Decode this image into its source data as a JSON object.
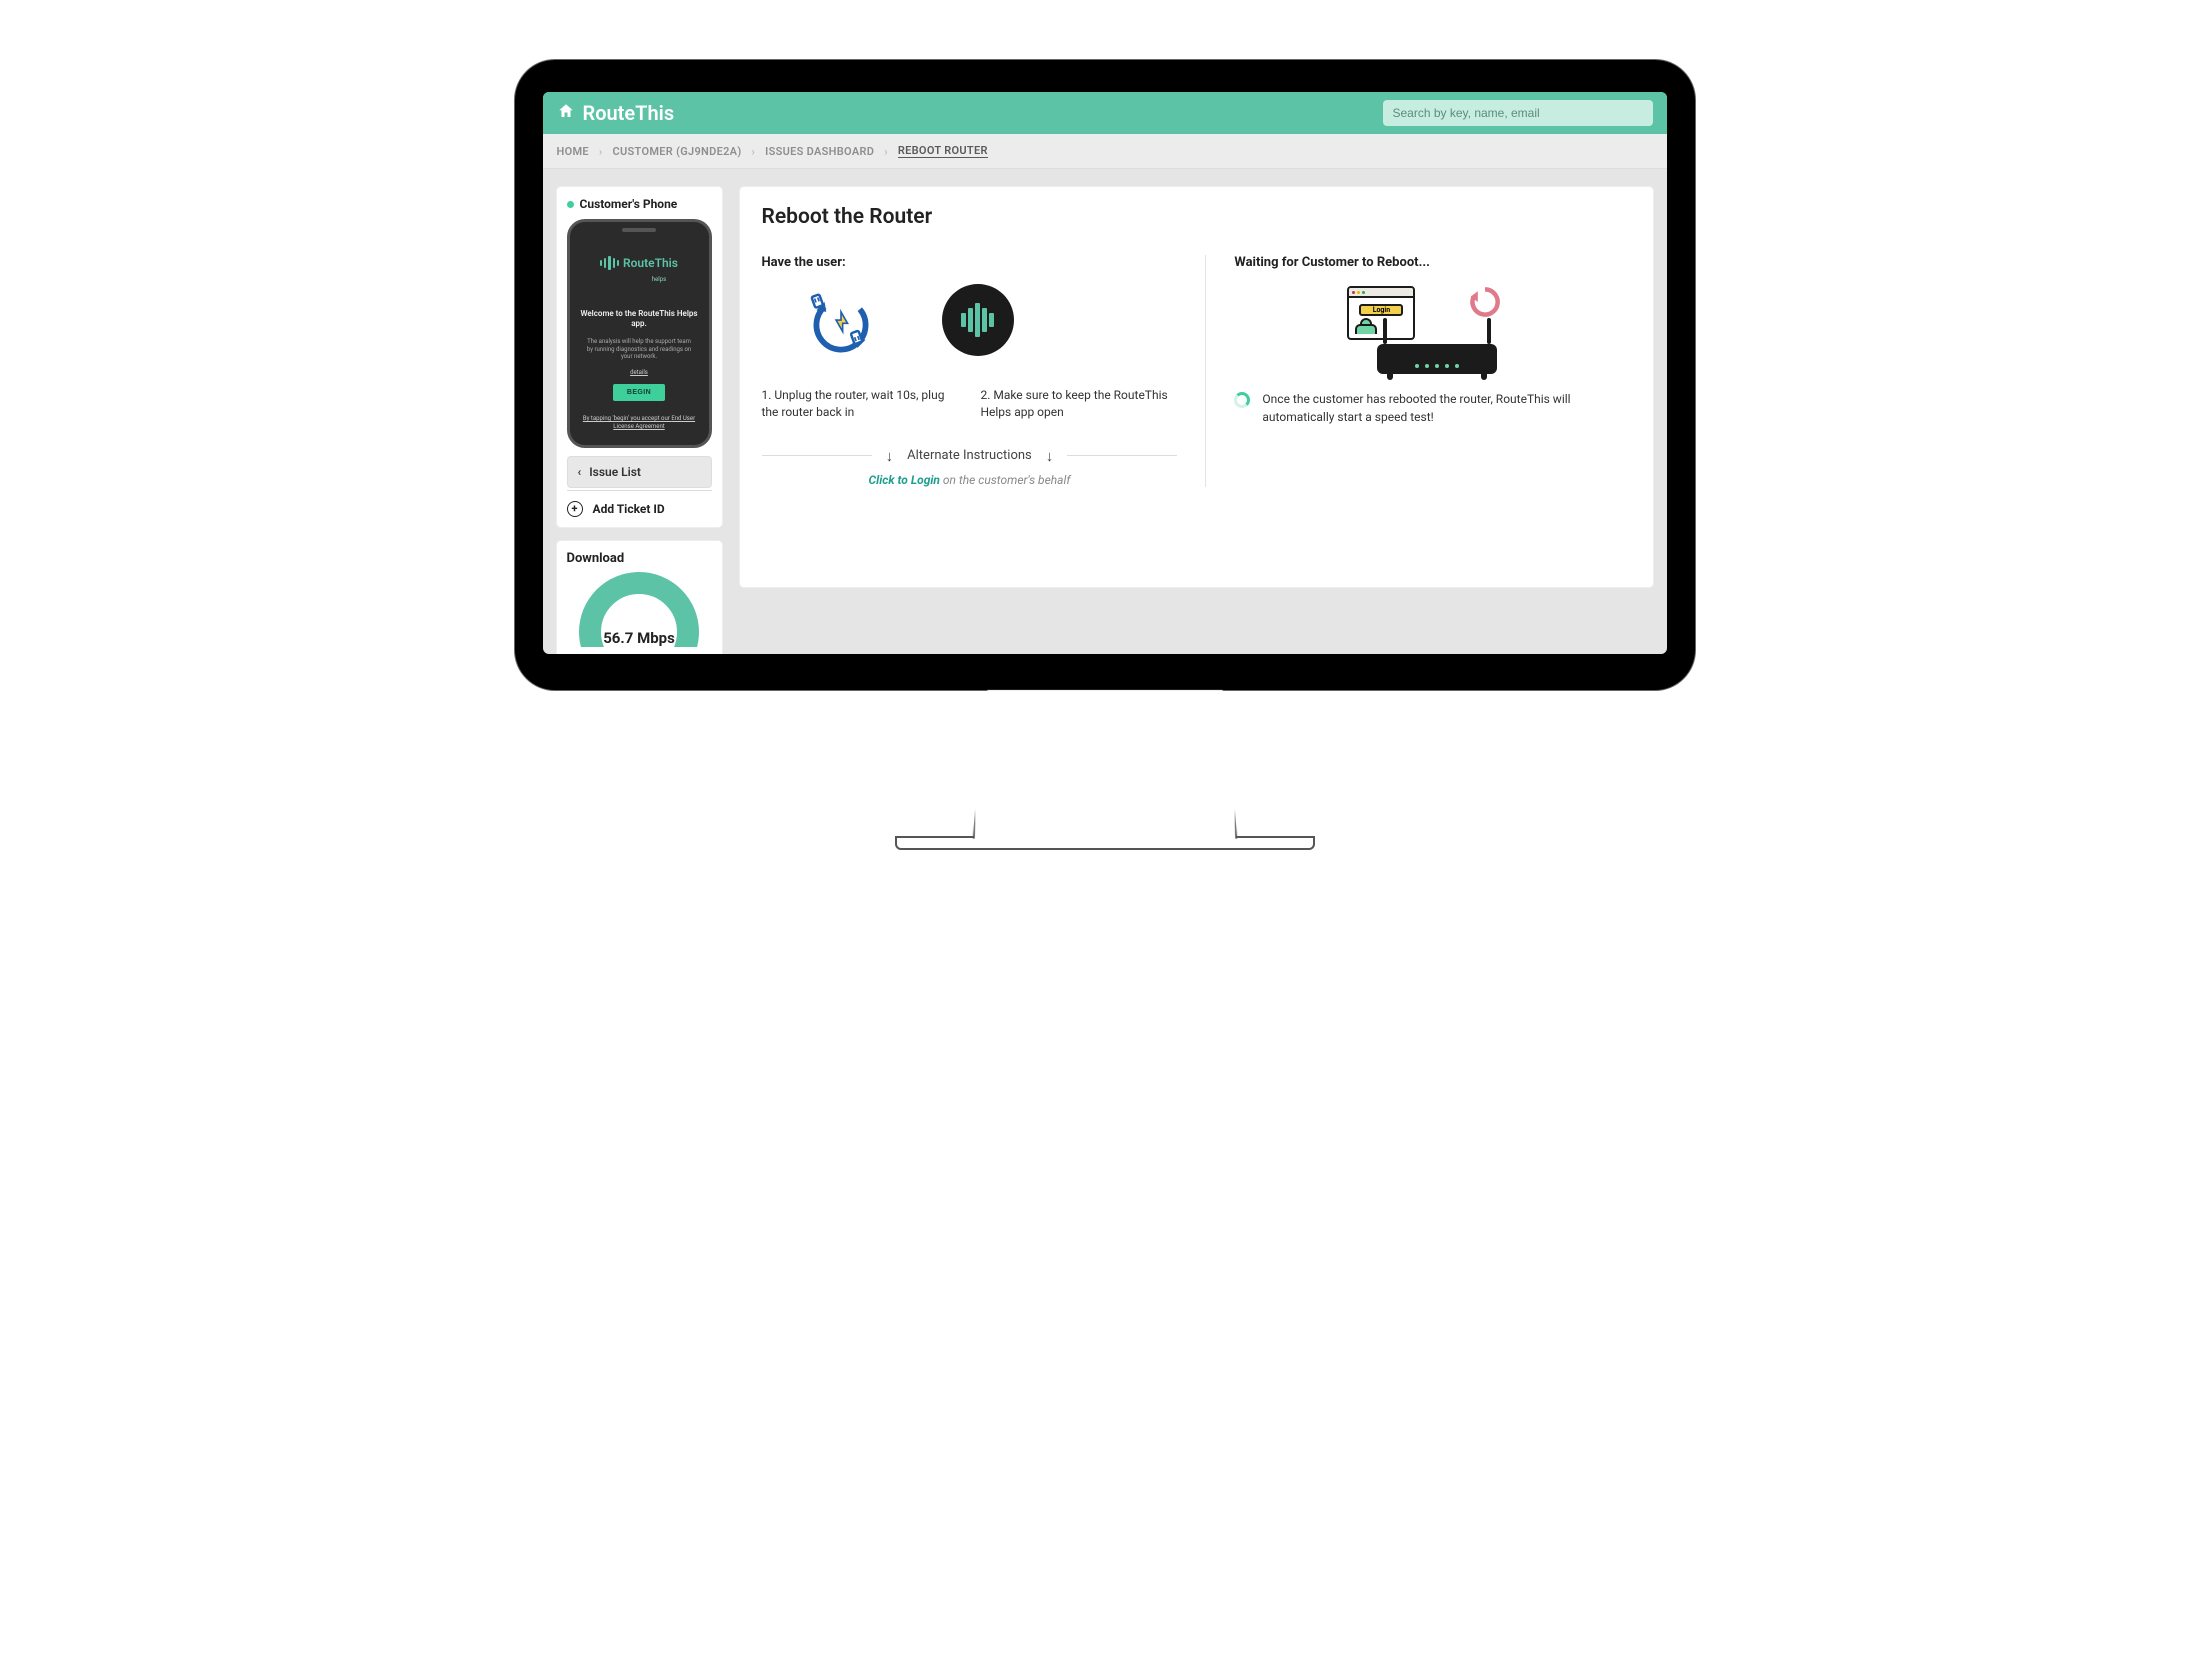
{
  "header": {
    "brand": "RouteThis",
    "search_placeholder": "Search by key, name, email"
  },
  "breadcrumbs": {
    "items": [
      {
        "label": "HOME"
      },
      {
        "label": "CUSTOMER (GJ9NDE2A)"
      },
      {
        "label": "ISSUES DASHBOARD"
      },
      {
        "label": "REBOOT ROUTER"
      }
    ]
  },
  "sidebar": {
    "phone_card_title": "Customer's Phone",
    "phone": {
      "logo_text": "RouteThis",
      "logo_sub": "helps",
      "welcome": "Welcome to the RouteThis Helps app.",
      "desc": "The analysis will help the support team by running diagnostics and readings on your network.",
      "details": "details",
      "begin": "BEGIN",
      "eula_prefix": "By tapping 'begin' you accept our ",
      "eula_link": "End User License Agreement"
    },
    "issue_list": "Issue List",
    "add_ticket": "Add Ticket ID",
    "download_title": "Download",
    "download_value": "56.7 Mbps"
  },
  "main": {
    "title": "Reboot the Router",
    "left": {
      "heading": "Have the user:",
      "step1": "1. Unplug the router, wait 10s, plug the router back in",
      "step2": "2. Make sure to keep the RouteThis Helps app open",
      "alt_label": "Alternate Instructions",
      "login_link": "Click to Login",
      "login_rest": " on the customer's behalf"
    },
    "right": {
      "heading": "Waiting for Customer to Reboot...",
      "login_chip": "Login",
      "note": "Once the customer has rebooted the router, RouteThis will automatically start a speed test!"
    }
  },
  "colors": {
    "accent": "#5cc3a6"
  }
}
